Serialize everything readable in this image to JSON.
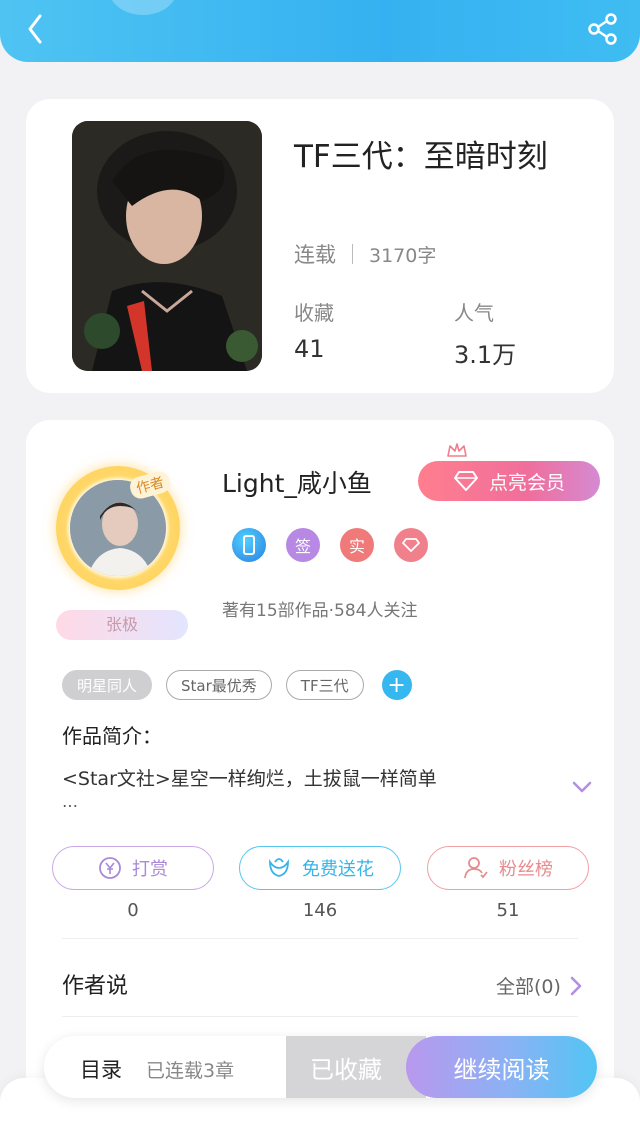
{
  "book": {
    "title": "TF三代：至暗时刻",
    "status": "连载",
    "word_count": "3170字",
    "favorites_label": "收藏",
    "favorites_value": "41",
    "popularity_label": "人气",
    "popularity_value": "3.1万"
  },
  "author": {
    "tag": "作者",
    "name": "Light_咸小鱼",
    "badge_name": "张极",
    "vip_label": "点亮会员",
    "badges": [
      "签",
      "实"
    ],
    "meta": "著有15部作品·584人关注"
  },
  "tags": [
    "明星同人",
    "Star最优秀",
    "TF三代"
  ],
  "intro": {
    "heading": "作品简介：",
    "text": "<Star文社>星空一样绚烂，土拔鼠一样简单",
    "more": "…"
  },
  "actions": {
    "tip_label": "打赏",
    "tip_count": "0",
    "flower_label": "免费送花",
    "flower_count": "146",
    "fans_label": "粉丝榜",
    "fans_count": "51"
  },
  "author_says": {
    "heading": "作者说",
    "all_label": "全部(0)"
  },
  "bottom": {
    "toc_label": "目录",
    "toc_count": "已连载3章",
    "fav_label": "已收藏",
    "read_label": "继续阅读"
  },
  "colors": {
    "header": "#35b1f1",
    "vip": "#f06e9c",
    "tip": "#a989d8",
    "flower": "#37b4ea",
    "fans": "#e88b8f"
  },
  "icons": [
    "back-icon",
    "share-icon",
    "crown-icon",
    "diamond-icon",
    "phone-badge-icon",
    "yen-icon",
    "flower-icon",
    "fans-icon",
    "chevron-down-icon",
    "chevron-right-icon"
  ]
}
